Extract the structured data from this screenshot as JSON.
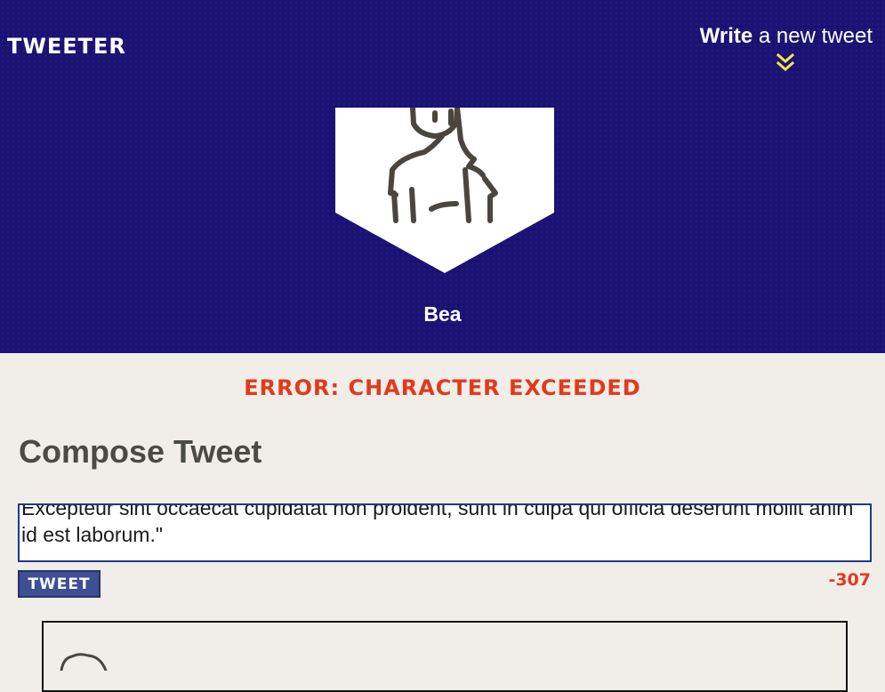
{
  "header": {
    "brand": "Tweeter",
    "nav": {
      "write_bold": "Write",
      "write_rest": " a new tweet",
      "toggle_icon": "double-chevron-down-icon"
    },
    "profile": {
      "avatar_icon": "woman-avatar-icon",
      "name": "Bea"
    }
  },
  "main": {
    "error_message": "Error: Character exceeded",
    "compose_title": "Compose Tweet",
    "tweet_input_value": "Excepteur sint occaecat cupidatat non proident, sunt in culpa qui officia deserunt mollit anim id est laborum.\"",
    "tweet_button_label": "Tweet",
    "char_counter": "-307"
  },
  "tweet_list": {
    "first_card_avatar_icon": "user-avatar-icon"
  },
  "colors": {
    "header_bg": "#1c1275",
    "page_bg": "#f1eee9",
    "error": "#e3391b",
    "chevron": "#f0e84a",
    "button_bg": "#3e4f96"
  }
}
